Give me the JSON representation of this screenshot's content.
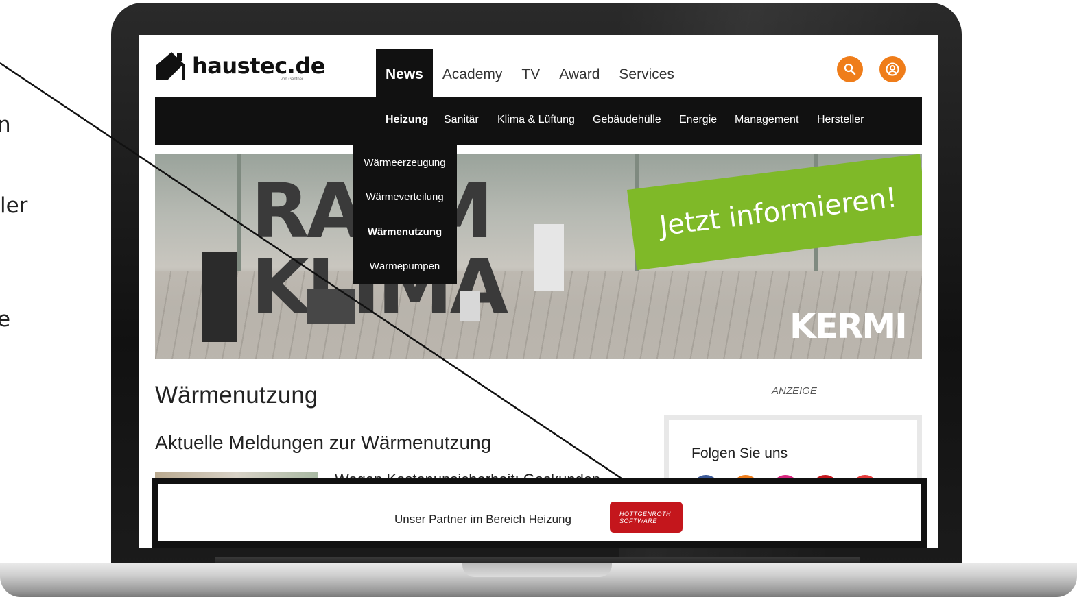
{
  "fragments": [
    "n",
    "ler",
    "e"
  ],
  "site": {
    "logo_text": "haustec.de",
    "logo_sub": "von Gentner"
  },
  "topnav": {
    "items": [
      "News",
      "Academy",
      "TV",
      "Award",
      "Services"
    ],
    "active": "News"
  },
  "icons": {
    "search": "search-icon",
    "user": "user-icon",
    "accent": "#ef7d1a"
  },
  "subnav": {
    "items": [
      "Heizung",
      "Sanitär",
      "Klima & Lüftung",
      "Gebäudehülle",
      "Energie",
      "Management",
      "Hersteller"
    ],
    "active": "Heizung"
  },
  "dropdown": {
    "items": [
      "Wärmeerzeugung",
      "Wärmeverteilung",
      "Wärmenutzung",
      "Wärmepumpen"
    ],
    "active": "Wärmenutzung"
  },
  "hero": {
    "letters_line1": "RAUM",
    "letters_line2": "KLIMA",
    "banner": "Jetzt informieren!",
    "brand": "KERMI",
    "banner_color": "#7fb928"
  },
  "main": {
    "title": "Wärmenutzung",
    "subtitle": "Aktuelle Meldungen zur Wärmenutzung",
    "article_title": "Wegen Kostenunsicherheit: Geskunden"
  },
  "sidebar": {
    "ad_label": "ANZEIGE",
    "follow_title": "Folgen Sie uns",
    "social_colors": [
      "#3b5998",
      "#ef7d1a",
      "#d8267e",
      "#c4161c",
      "#e63b3b"
    ]
  },
  "partner": {
    "text": "Unser Partner im Bereich Heizung",
    "logo_line1": "HOTTGENROTH",
    "logo_line2": "SOFTWARE",
    "logo_color": "#c4161c"
  }
}
